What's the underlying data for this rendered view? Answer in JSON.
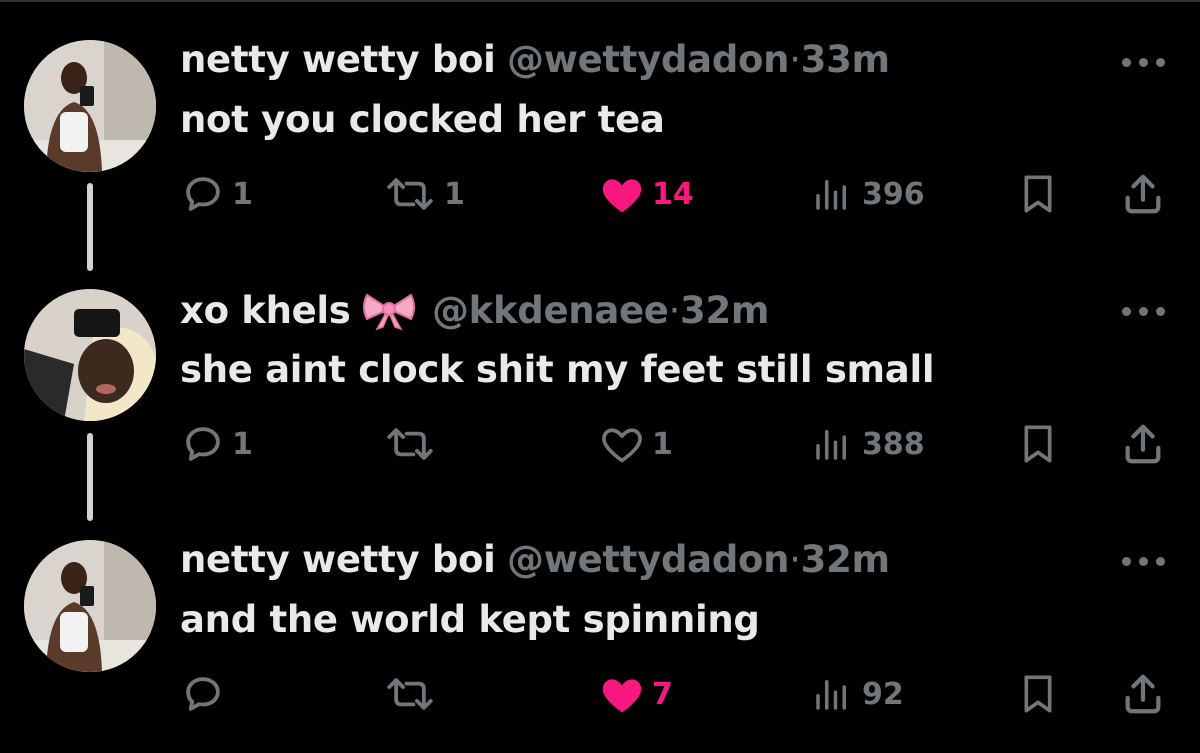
{
  "colors": {
    "background": "#000000",
    "text": "#e7e9ea",
    "muted": "#71767b",
    "like": "#f91880"
  },
  "tweets": [
    {
      "name": "netty wetty boi",
      "handle": "@wettydadon",
      "sep": "·",
      "time": "33m",
      "text": "not you clocked her tea",
      "replies": "1",
      "retweets": "1",
      "likes": "14",
      "liked": true,
      "views": "396"
    },
    {
      "name": "xo khels",
      "emoji": "ribbon-icon",
      "handle": "@kkdenaee",
      "sep": "·",
      "time": "32m",
      "text": "she aint clock shit my feet still small",
      "replies": "1",
      "retweets": "",
      "likes": "1",
      "liked": false,
      "views": "388"
    },
    {
      "name": "netty wetty boi",
      "handle": "@wettydadon",
      "sep": "·",
      "time": "32m",
      "text": "and the world kept spinning",
      "replies": "",
      "retweets": "",
      "likes": "7",
      "liked": true,
      "views": "92"
    }
  ]
}
